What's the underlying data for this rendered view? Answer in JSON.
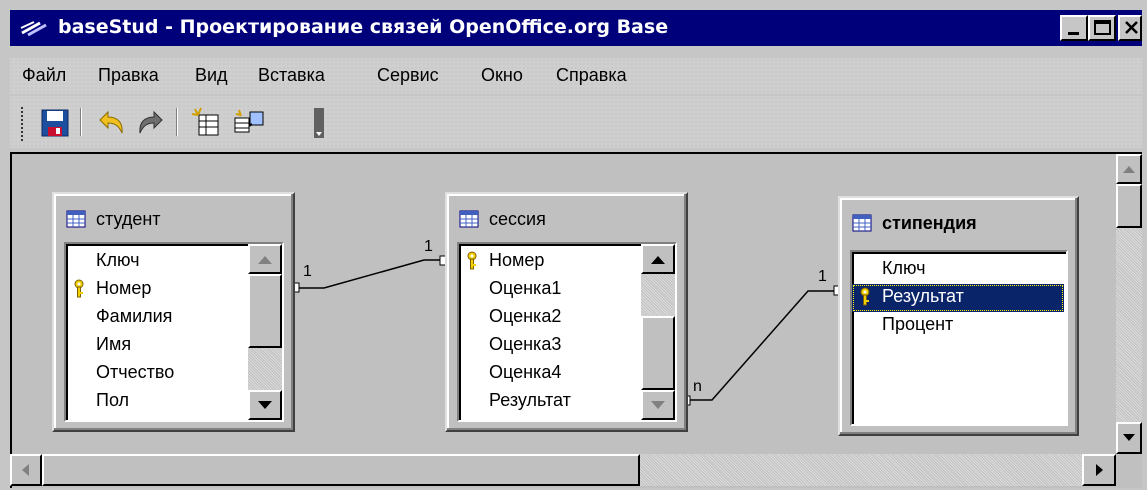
{
  "window": {
    "title": "baseStud - Проектирование связей OpenOffice.org Base",
    "controls": [
      "minimize-icon",
      "maximize-icon",
      "close-icon"
    ]
  },
  "menu": [
    {
      "label": "Файл",
      "name": "file"
    },
    {
      "label": "Правка",
      "name": "edit"
    },
    {
      "label": "Вид",
      "name": "view"
    },
    {
      "label": "Вставка",
      "name": "insert"
    },
    {
      "label": "Сервис",
      "name": "tools"
    },
    {
      "label": "Окно",
      "name": "window"
    },
    {
      "label": "Справка",
      "name": "help"
    }
  ],
  "toolbar": {
    "icons": [
      "save-icon",
      "undo-icon",
      "redo-icon",
      "new-table-icon",
      "new-relation-icon",
      "more-icon"
    ]
  },
  "tables": {
    "student": {
      "title": "студент",
      "fields": [
        "Ключ",
        "Номер",
        "Фамилия",
        "Имя",
        "Отчество",
        "Пол"
      ],
      "key_field": "Номер"
    },
    "session": {
      "title": "сессия",
      "fields": [
        "Номер",
        "Оценка1",
        "Оценка2",
        "Оценка3",
        "Оценка4",
        "Результат"
      ],
      "key_field": "Номер"
    },
    "stipend": {
      "title": "стипендия",
      "fields": [
        "Ключ",
        "Результат",
        "Процент"
      ],
      "key_field": "Результат",
      "selected_field": "Результат"
    }
  },
  "relations": [
    {
      "from": "студент",
      "to": "сессия",
      "from_card": "1",
      "to_card": "1"
    },
    {
      "from": "сессия",
      "to": "стипендия",
      "from_card": "n",
      "to_card": "1"
    }
  ],
  "colors": {
    "titlebar": "#00007b",
    "selection": "#0a246a",
    "face": "#c0c0c0"
  }
}
